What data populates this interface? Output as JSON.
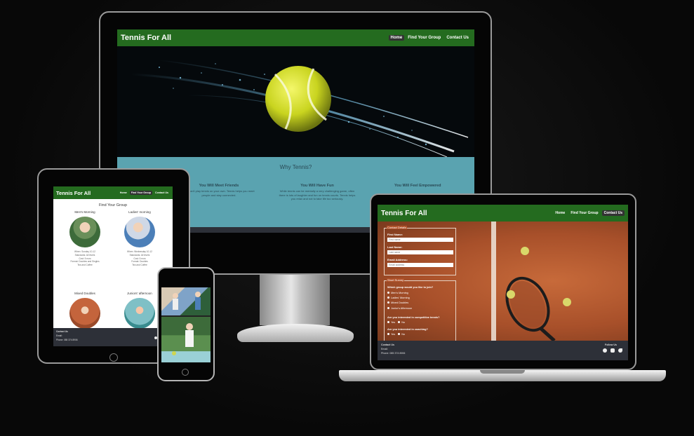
{
  "site": {
    "brand": "Tennis For All",
    "nav": [
      "Home",
      "Find Your Group",
      "Contact Us"
    ]
  },
  "monitor": {
    "why_title": "Why Tennis?",
    "features": [
      {
        "title": "You Will Meet Friends",
        "text": "You can't play tennis on your own. Tennis helps you meet people and stay connected."
      },
      {
        "title": "You Will Have Fun",
        "text": "While tennis can be mentally a very challenging game, often there is lots of laughter and fun on tennis courts. Tennis helps you relax and not to take life too seriously."
      },
      {
        "title": "You Will Feel Empowered",
        "text": ""
      }
    ],
    "partial_left": "...ant only ...ead to a ...ing your life"
  },
  "tablet": {
    "page_title": "Find Your Group",
    "groups": [
      {
        "name": "Men's Morning",
        "details": [
          "When: Sunday 10-12",
          "Standards: All levels",
          "Cost: 5 euro",
          "Format: Doubles and Singles",
          "Tea and Coffee"
        ]
      },
      {
        "name": "Ladies' morning",
        "details": [
          "When: Wednesday 10-12",
          "Standards: All levels",
          "Cost: 5 euro",
          "Format: Doubles",
          "Tea and Coffee"
        ]
      },
      {
        "name": "Mixed Doubles",
        "details": []
      },
      {
        "name": "Juniors' afternoon",
        "details": []
      }
    ],
    "footer": {
      "contact": "Contact Us",
      "email": "Email:",
      "phone": "Phone: 085 374 8906",
      "follow": "Follo"
    }
  },
  "laptop": {
    "contact_legend": "Contact Details",
    "first_name_label": "First Name:",
    "first_name_placeholder": "First name",
    "last_name_label": "Last Name:",
    "last_name_placeholder": "Last name",
    "email_label": "Email Address:",
    "email_placeholder": "Email address",
    "survey_legend": "Short Survey",
    "q1": "Which group would you like to join?",
    "q1_options": [
      "Men's Morning",
      "Ladies' Morning",
      "Mixed Doubles",
      "Junior's Afternoon"
    ],
    "q2": "Are you interested in competitive tennis?",
    "q3": "Are you interested in coaching?",
    "yes": "Yes",
    "no": "No",
    "footer": {
      "contact": "Contact Us",
      "email": "Email:",
      "phone": "Phone: 085 374 8906",
      "follow": "Follow Us"
    }
  },
  "icons": {
    "social": [
      "facebook-icon",
      "instagram-icon",
      "twitter-icon"
    ]
  },
  "colors": {
    "nav_green": "#246b1f",
    "teal_section": "#5aa3b0",
    "footer_dark": "#2d3038",
    "clay": "#b0522a"
  }
}
